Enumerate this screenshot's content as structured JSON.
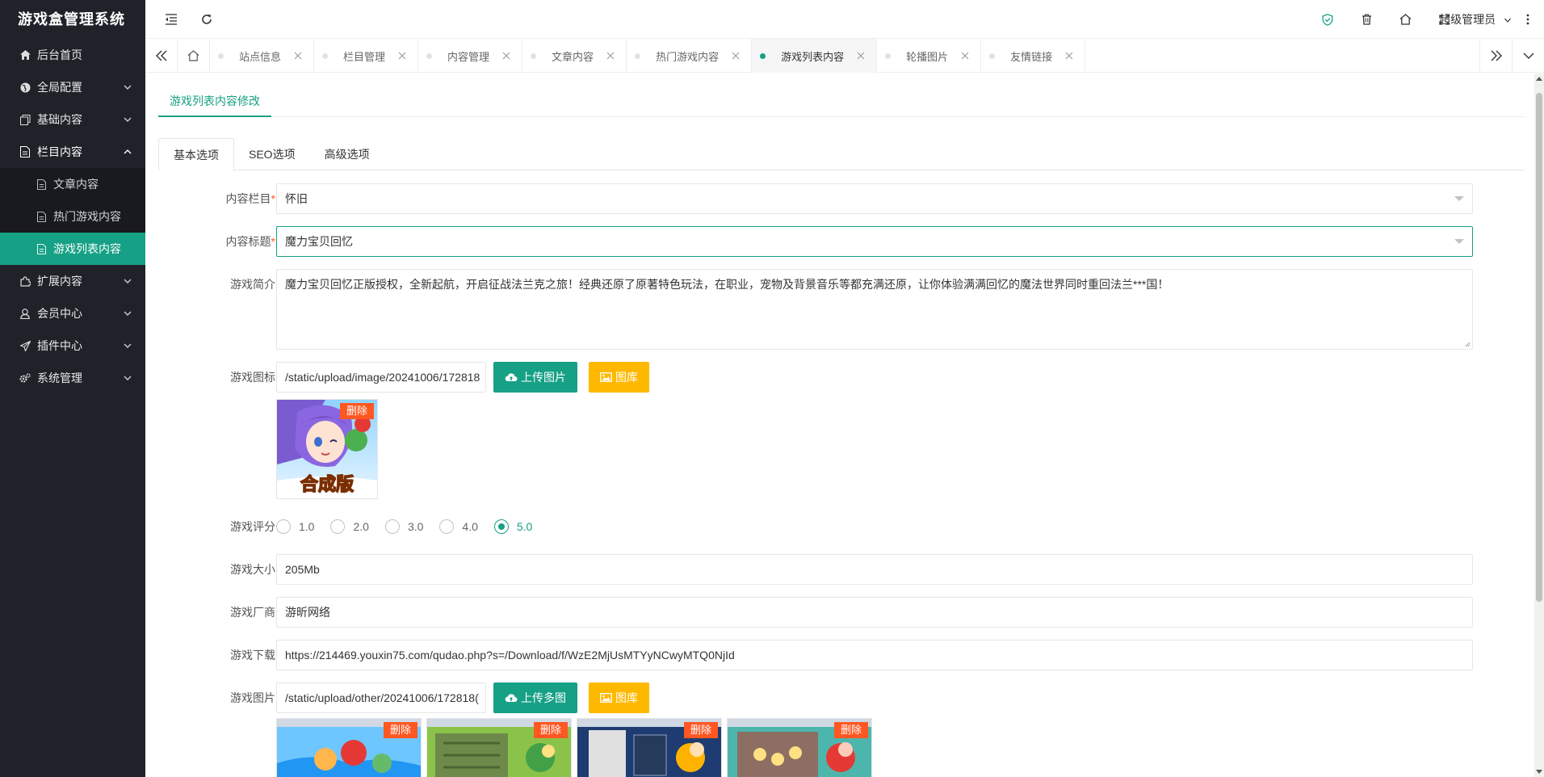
{
  "app": {
    "title": "游戏盒管理系统"
  },
  "sidebar": {
    "items": [
      {
        "label": "后台首页",
        "icon": "home-icon"
      },
      {
        "label": "全局配置",
        "icon": "globe-icon"
      },
      {
        "label": "基础内容",
        "icon": "copy-icon"
      },
      {
        "label": "栏目内容",
        "icon": "file-icon",
        "expanded": true,
        "children": [
          {
            "label": "文章内容"
          },
          {
            "label": "热门游戏内容"
          },
          {
            "label": "游戏列表内容",
            "active": true
          }
        ]
      },
      {
        "label": "扩展内容",
        "icon": "puzzle-icon"
      },
      {
        "label": "会员中心",
        "icon": "user-icon"
      },
      {
        "label": "插件中心",
        "icon": "send-icon"
      },
      {
        "label": "系统管理",
        "icon": "gears-icon"
      }
    ]
  },
  "header": {
    "user": "超级管理员"
  },
  "tabs": [
    {
      "label": "站点信息"
    },
    {
      "label": "栏目管理"
    },
    {
      "label": "内容管理"
    },
    {
      "label": "文章内容"
    },
    {
      "label": "热门游戏内容"
    },
    {
      "label": "游戏列表内容",
      "active": true
    },
    {
      "label": "轮播图片"
    },
    {
      "label": "友情链接"
    }
  ],
  "page": {
    "title": "游戏列表内容修改",
    "form_tabs": [
      "基本选项",
      "SEO选项",
      "高级选项"
    ],
    "active_form_tab": "基本选项"
  },
  "form": {
    "category": {
      "label": "内容栏目",
      "required_mark": "*",
      "value": "怀旧"
    },
    "title": {
      "label": "内容标题",
      "required_mark": "*",
      "value": "魔力宝贝回忆"
    },
    "intro": {
      "label": "游戏简介",
      "value": "魔力宝贝回忆正版授权，全新起航，开启征战法兰克之旅！经典还原了原著特色玩法，在职业，宠物及背景音乐等都充满还原，让你体验满满回忆的魔法世界同时重回法兰***国！"
    },
    "icon": {
      "label": "游戏图标",
      "value": "/static/upload/image/20241006/172818",
      "upload_label": "上传图片",
      "gallery_label": "图库",
      "delete_label": "删除",
      "thumb_text": "合成版"
    },
    "rating": {
      "label": "游戏评分",
      "options": [
        "1.0",
        "2.0",
        "3.0",
        "4.0",
        "5.0"
      ],
      "selected": "5.0"
    },
    "size": {
      "label": "游戏大小",
      "value": "205Mb"
    },
    "vendor": {
      "label": "游戏厂商",
      "value": "游昕网络"
    },
    "download": {
      "label": "游戏下载",
      "value": "https://214469.youxin75.com/qudao.php?s=/Download/f/WzE2MjUsMTYyNCwyMTQ0NjId"
    },
    "images": {
      "label": "游戏图片",
      "value": "/static/upload/other/20241006/172818(",
      "upload_label": "上传多图",
      "gallery_label": "图库",
      "delete_label": "删除"
    }
  },
  "colors": {
    "accent": "#16a085",
    "sidebar_bg": "#20222a",
    "danger": "#ff5722",
    "warn": "#ffb800"
  }
}
